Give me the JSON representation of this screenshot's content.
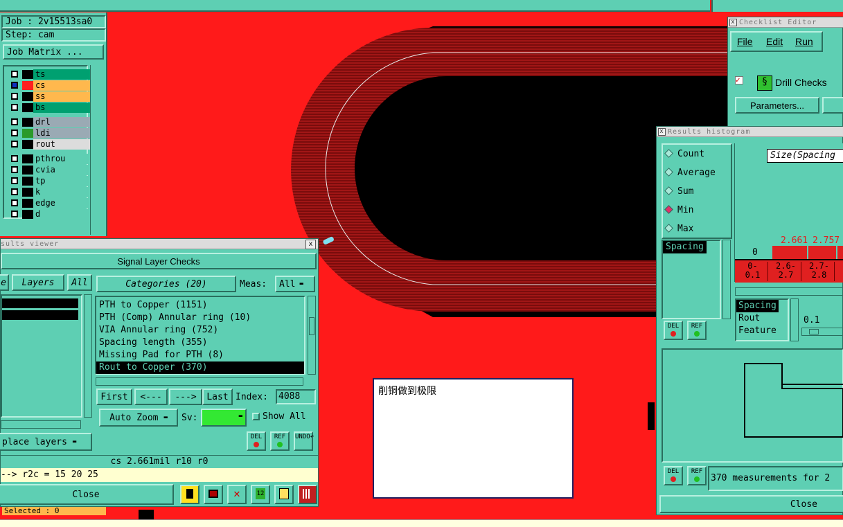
{
  "left_panel": {
    "job": "Job : 2v15513sa0",
    "step": "Step: cam",
    "job_matrix_label": "Job Matrix ...",
    "layers": [
      {
        "name": "ts",
        "color": "#00a070",
        "swatch": "#000000",
        "checked": false
      },
      {
        "name": "cs",
        "color": "#ffb84d",
        "swatch": "#ff2020",
        "checked": true
      },
      {
        "name": "ss",
        "color": "#ffb84d",
        "swatch": "#000000",
        "checked": false
      },
      {
        "name": "bs",
        "color": "#00a070",
        "swatch": "#000000",
        "checked": false
      },
      {
        "name": "drl",
        "color": "#9aaab4",
        "swatch": "#000000",
        "checked": false
      },
      {
        "name": "ldi",
        "color": "#9aaab4",
        "swatch": "#2a9a2a",
        "checked": false
      },
      {
        "name": "rout",
        "color": "#dcdcdc",
        "swatch": "#000000",
        "checked": false
      },
      {
        "name": "pthrou",
        "color": "#5ecfb3",
        "swatch": "#000000",
        "checked": false
      },
      {
        "name": "cvia",
        "color": "#5ecfb3",
        "swatch": "#000000",
        "checked": false
      },
      {
        "name": "tp",
        "color": "#5ecfb3",
        "swatch": "#000000",
        "checked": false
      },
      {
        "name": "k",
        "color": "#5ecfb3",
        "swatch": "#000000",
        "checked": false
      },
      {
        "name": "edge",
        "color": "#5ecfb3",
        "swatch": "#000000",
        "checked": false
      },
      {
        "name": "d",
        "color": "#5ecfb3",
        "swatch": "#000000",
        "checked": false
      }
    ]
  },
  "results_viewer": {
    "title": "sults viewer",
    "close_x": "x",
    "header": "Signal Layer Checks",
    "tab_e": "e",
    "tab_layers": "Layers",
    "tab_all": "All",
    "categories_label": "Categories (20)",
    "meas_label": "Meas:",
    "meas_value": "All",
    "categories": [
      "PTH to Copper (1151)",
      "PTH (Comp) Annular ring (10)",
      "VIA Annular ring (752)",
      "Spacing length (355)",
      "Missing Pad for PTH (8)",
      "Rout to Copper (370)"
    ],
    "selected_index": 5,
    "first": "First",
    "prev": "<---",
    "next": "--->",
    "last": "Last",
    "index_label": "Index:",
    "index_value": "4088",
    "auto_zoom": "Auto Zoom",
    "sv_label": "Sv:",
    "show_all": "Show All",
    "place_layers": "place layers",
    "del": "DEL",
    "ref": "REF",
    "undo": "UNDO",
    "status": "cs 2.661mil  r10  r0",
    "formula": "--> r2c = 15 20 25",
    "close": "Close",
    "selected_text": "Selected : 0"
  },
  "note": {
    "text": "削铜做到极限"
  },
  "checklist_editor": {
    "title": "Checklist Editor",
    "menu": [
      "File",
      "Edit",
      "Run"
    ],
    "item": "Drill Checks",
    "parameters": "Parameters..."
  },
  "histogram": {
    "title": "Results histogram",
    "modes": [
      "Count",
      "Average",
      "Sum",
      "Min",
      "Max"
    ],
    "selected_mode": "Min",
    "heading": "Size(Spacing",
    "axis_zero": "0",
    "bar_labels": [
      "2.661",
      "2.757"
    ],
    "bins": [
      [
        "0-",
        "0.1"
      ],
      [
        "2.6-",
        "2.7"
      ],
      [
        "2.7-",
        "2.8"
      ]
    ],
    "left_list": [
      "Spacing"
    ],
    "right_list": [
      "Spacing",
      "Rout",
      "Feature"
    ],
    "right_list_selected": "Spacing",
    "value": "0.1",
    "del": "DEL",
    "ref": "REF",
    "measurements": "370 measurements for 2",
    "close": "Close"
  },
  "colors": {
    "teal": "#5ecfb3",
    "canvas_red": "#ff1a1a",
    "copper_ring": "#9a1010",
    "black": "#000000"
  }
}
